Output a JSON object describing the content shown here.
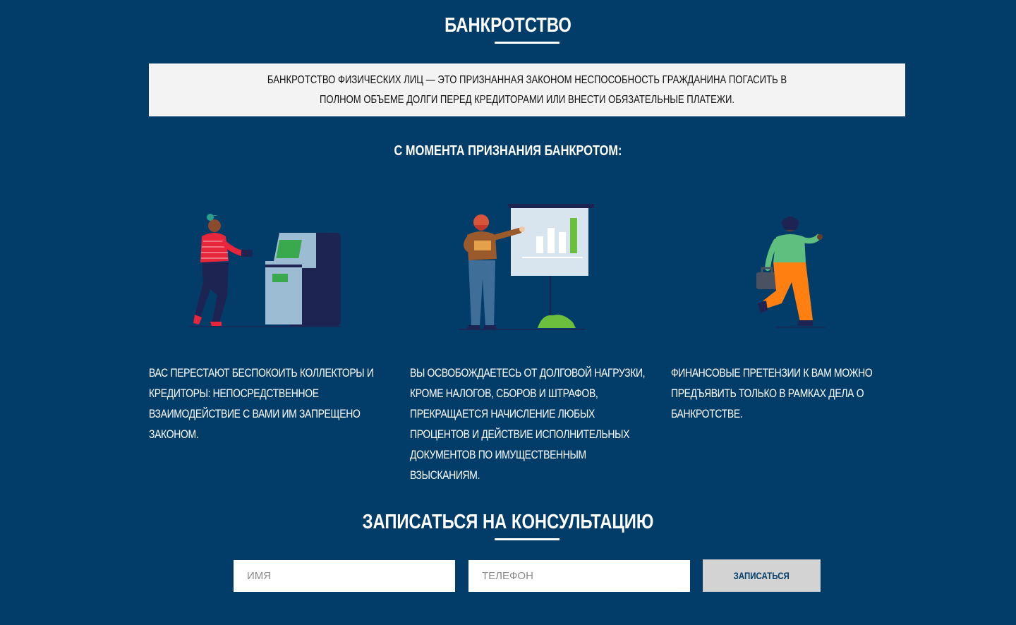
{
  "bankruptcy": {
    "title": "БАНКРОТСТВО",
    "definition": "БАНКРОТСТВО ФИЗИЧЕСКИХ ЛИЦ — ЭТО ПРИЗНАННАЯ ЗАКОНОМ НЕСПОСОБНОСТЬ ГРАЖДАНИНА ПОГАСИТЬ В ПОЛНОМ ОБЪЕМЕ ДОЛГИ ПЕРЕД КРЕДИТОРАМИ ИЛИ ВНЕСТИ ОБЯЗАТЕЛЬНЫЕ ПЛАТЕЖИ.",
    "subtitle": "С МОМЕНТА ПРИЗНАНИЯ БАНКРОТОМ:",
    "benefits": [
      {
        "text": "ВАС ПЕРЕСТАЮТ БЕСПОКОИТЬ КОЛЛЕКТОРЫ И КРЕДИТОРЫ: НЕПОСРЕДСТВЕННОЕ ВЗАИМОДЕЙСТВИЕ С ВАМИ ИМ ЗАПРЕЩЕНО ЗАКОНОМ.",
        "illustration": "woman-atm-illustration"
      },
      {
        "text": "ВЫ ОСВОБОЖДАЕТЕСЬ ОТ ДОЛГОВОЙ НАГРУЗКИ, КРОМЕ НАЛОГОВ, СБОРОВ И ШТРАФОВ, ПРЕКРАЩАЕТСЯ НАЧИСЛЕНИЕ ЛЮБЫХ ПРОЦЕНТОВ И ДЕЙСТВИЕ ИСПОЛНИТЕЛЬНЫХ ДОКУМЕНТОВ ПО ИМУЩЕСТВЕННЫМ ВЗЫСКАНИЯМ.",
        "illustration": "man-presentation-illustration"
      },
      {
        "text": "ФИНАНСОВЫЕ ПРЕТЕНЗИИ К ВАМ МОЖНО ПРЕДЪЯВИТЬ ТОЛЬКО В РАМКАХ ДЕЛА О БАНКРОТСТВЕ.",
        "illustration": "woman-briefcase-illustration"
      }
    ]
  },
  "consultation": {
    "title": "ЗАПИСАТЬСЯ НА КОНСУЛЬТАЦИЮ",
    "name_placeholder": "ИМЯ",
    "phone_placeholder": "ТЕЛЕФОН",
    "submit_label": "ЗАПИСАТЬСЯ"
  },
  "colors": {
    "background": "#023d69",
    "box": "#f3f3f3",
    "button": "#d3d3d3",
    "button_text": "#023d69"
  }
}
